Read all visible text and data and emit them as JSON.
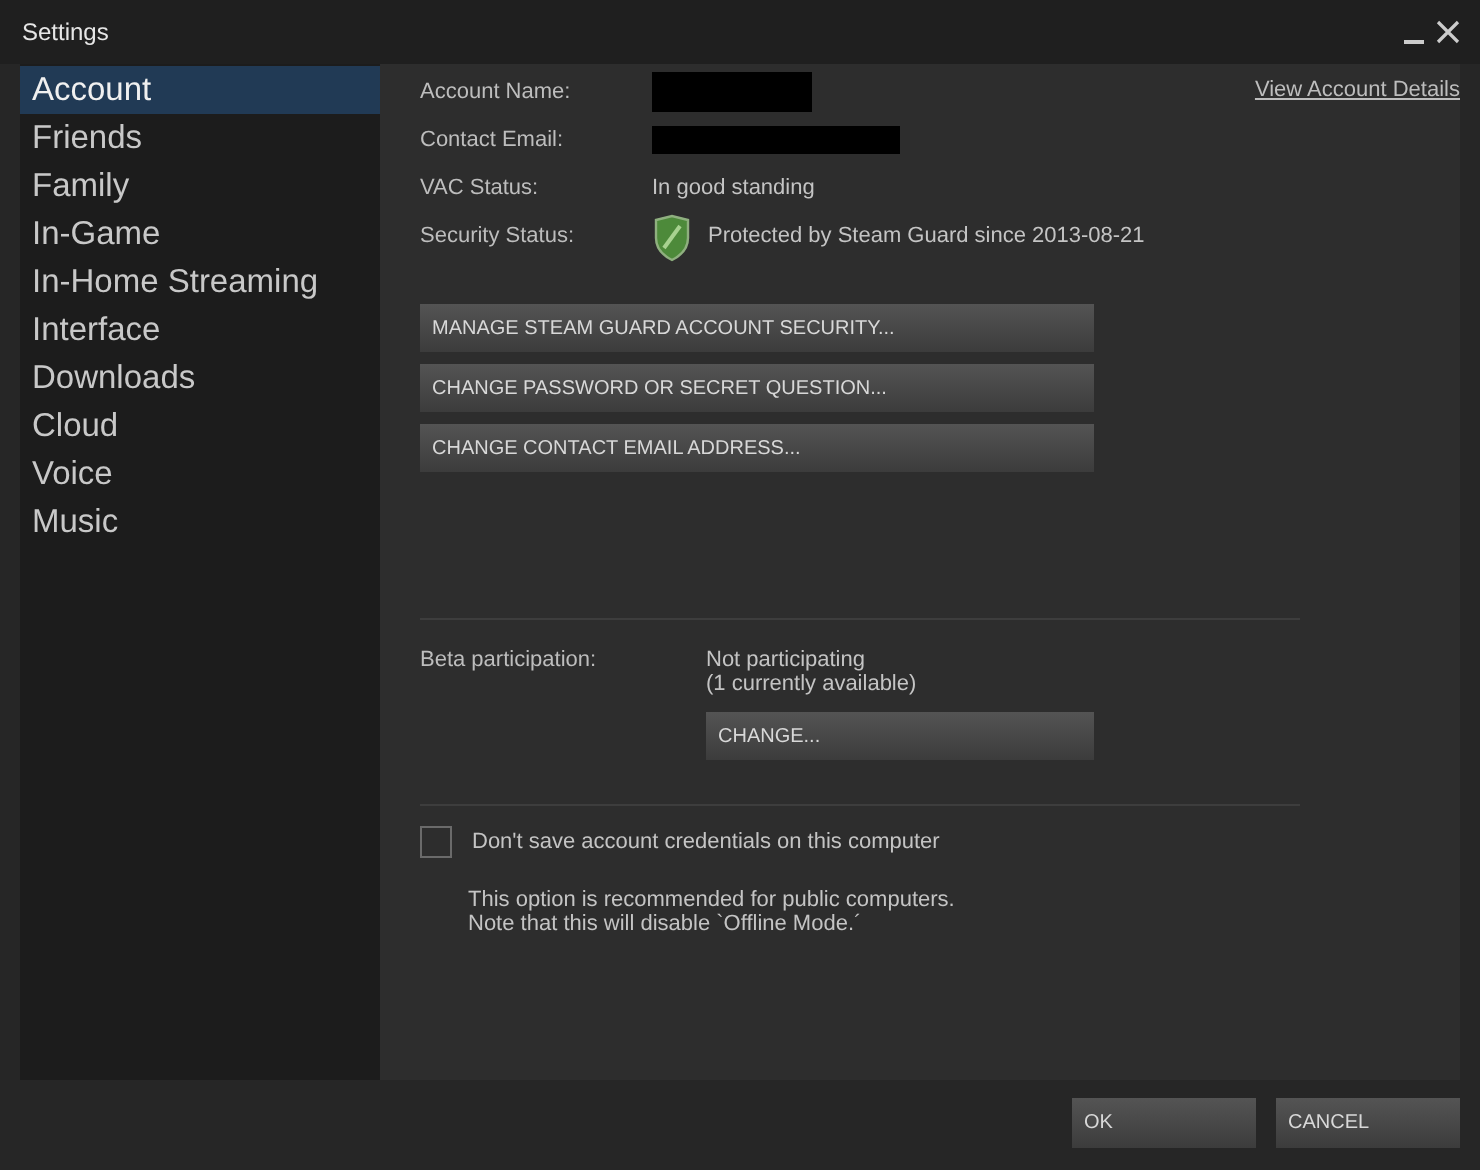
{
  "window": {
    "title": "Settings"
  },
  "sidebar": {
    "items": [
      {
        "label": "Account",
        "selected": true
      },
      {
        "label": "Friends",
        "selected": false
      },
      {
        "label": "Family",
        "selected": false
      },
      {
        "label": "In-Game",
        "selected": false
      },
      {
        "label": "In-Home Streaming",
        "selected": false
      },
      {
        "label": "Interface",
        "selected": false
      },
      {
        "label": "Downloads",
        "selected": false
      },
      {
        "label": "Cloud",
        "selected": false
      },
      {
        "label": "Voice",
        "selected": false
      },
      {
        "label": "Music",
        "selected": false
      }
    ]
  },
  "account": {
    "link": "View Account Details",
    "fields": [
      {
        "label": "Account Name:",
        "redacted": true
      },
      {
        "label": "Contact Email:",
        "redacted": true
      },
      {
        "label": "VAC Status:",
        "redacted": false,
        "value": "In good standing"
      },
      {
        "label": "Security Status:",
        "redacted": false,
        "shield": true,
        "value": "Protected by Steam Guard since 2013-08-21"
      }
    ],
    "buttons": [
      "MANAGE STEAM GUARD ACCOUNT SECURITY...",
      "CHANGE PASSWORD OR SECRET QUESTION...",
      "CHANGE CONTACT EMAIL ADDRESS..."
    ]
  },
  "beta": {
    "label": "Beta participation:",
    "status": "Not participating",
    "available": "(1 currently available)",
    "button": "CHANGE..."
  },
  "credentials": {
    "label": "Don't save account credentials on this computer",
    "checked": false,
    "note": [
      "This option is recommended for public computers.",
      "Note that this will disable `Offline Mode.´"
    ]
  },
  "footer": {
    "buttons": [
      "OK",
      "CANCEL"
    ]
  }
}
